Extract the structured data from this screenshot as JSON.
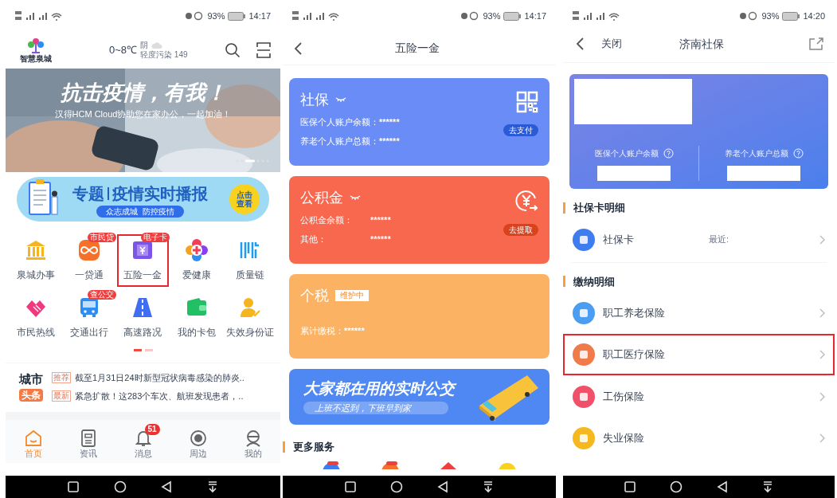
{
  "home_screen": {
    "status_bar": {
      "battery": "93%",
      "time": "14:17"
    },
    "logo_text": "智慧泉城",
    "weather": {
      "temperature": "0~8℃",
      "condition": "阴",
      "air_quality": "轻度污染 149"
    },
    "banner": {
      "headline": "抗击疫情，有我！",
      "subline": "汉得HCM Cloud协助您在家办公，一起加油！"
    },
    "topic_banner": {
      "tag": "专题",
      "title": "疫情实时播报",
      "slogan": "众志成城  防控疫情",
      "button": "点击查看"
    },
    "services": [
      {
        "label": "泉城办事",
        "highlighted": false
      },
      {
        "label": "一贷通",
        "badge": "市民贷",
        "highlighted": false
      },
      {
        "label": "五险一金",
        "badge": "电子卡",
        "highlighted": true
      },
      {
        "label": "爱健康",
        "highlighted": false
      },
      {
        "label": "质量链",
        "highlighted": false
      },
      {
        "label": "市民热线",
        "highlighted": false
      },
      {
        "label": "交通出行",
        "badge": "查公交",
        "highlighted": false
      },
      {
        "label": "高速路况",
        "highlighted": false
      },
      {
        "label": "我的卡包",
        "highlighted": false
      },
      {
        "label": "失效身份证",
        "highlighted": false
      }
    ],
    "news": {
      "title": "城市",
      "tag": "头条",
      "items": [
        {
          "tag": "推荐",
          "text": "截至1月31日24时新型冠状病毒感染的肺炎.."
        },
        {
          "tag": "最新",
          "text": "紧急扩散！这283个车次、航班发现患者，.."
        }
      ]
    },
    "tabs": [
      {
        "label": "首页",
        "selected": true
      },
      {
        "label": "资讯",
        "selected": false
      },
      {
        "label": "消息",
        "selected": false,
        "badge": "51"
      },
      {
        "label": "周边",
        "selected": false
      },
      {
        "label": "我的",
        "selected": false
      }
    ]
  },
  "five_insurance_screen": {
    "status_bar": {
      "battery": "93%",
      "time": "14:17"
    },
    "title": "五险一金",
    "cards": [
      {
        "kind": "social",
        "title": "社保",
        "rows": [
          {
            "label": "医保个人账户余额：",
            "value": "******"
          },
          {
            "label": "养老个人账户总额：",
            "value": "******"
          }
        ],
        "button": "去支付"
      },
      {
        "kind": "fund",
        "title": "公积金",
        "rows": [
          {
            "label": "公积金余额：",
            "value": "******"
          },
          {
            "label": "其他：",
            "value": "******"
          }
        ],
        "button": "去提取"
      },
      {
        "kind": "tax",
        "title": "个税",
        "tag": "维护中",
        "rows": [
          {
            "label": "累计缴税：",
            "value": "******"
          }
        ]
      }
    ],
    "bus_banner": {
      "title": "大家都在用的实时公交",
      "subtitle": "上班不迟到，下班早到家"
    },
    "section_title": "更多服务"
  },
  "social_security_screen": {
    "status_bar": {
      "battery": "93%",
      "time": "14:20"
    },
    "close": "关闭",
    "title": "济南社保",
    "summary": [
      {
        "label": "医保个人账户余额"
      },
      {
        "label": "养老个人账户总额"
      }
    ],
    "card_section": {
      "title": "社保卡明细",
      "rows": [
        {
          "label": "社保卡",
          "note": "最近:",
          "color": "#3f7cf0"
        }
      ]
    },
    "payment_section": {
      "title": "缴纳明细",
      "rows": [
        {
          "label": "职工养老保险",
          "color": "#4a9df0",
          "highlighted": false
        },
        {
          "label": "职工医疗保险",
          "color": "#f07a4a",
          "highlighted": true
        },
        {
          "label": "工伤保险",
          "color": "#f0506a",
          "highlighted": false
        },
        {
          "label": "失业保险",
          "color": "#f5b81e",
          "highlighted": false
        }
      ]
    }
  }
}
